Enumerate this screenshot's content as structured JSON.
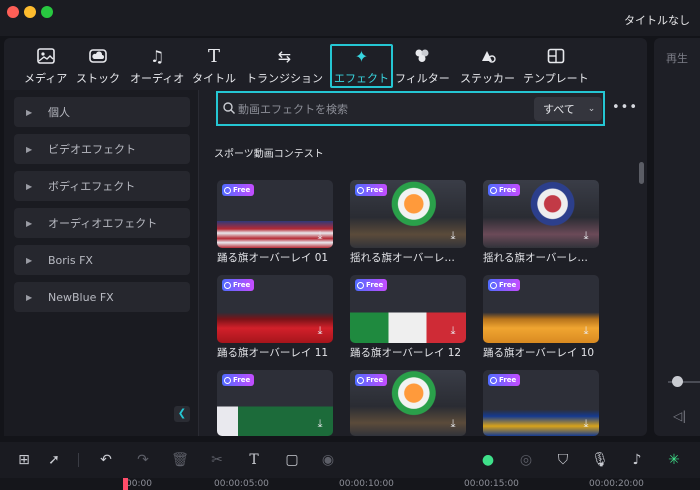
{
  "window": {
    "title": "タイトルなし"
  },
  "tabs": [
    {
      "label": "メディア",
      "icon": "media-icon"
    },
    {
      "label": "ストック",
      "icon": "cloud-icon"
    },
    {
      "label": "オーディオ",
      "icon": "music-icon"
    },
    {
      "label": "タイトル",
      "icon": "title-icon"
    },
    {
      "label": "トランジション",
      "icon": "transition-icon"
    },
    {
      "label": "エフェクト",
      "icon": "effect-icon",
      "active": true
    },
    {
      "label": "フィルター",
      "icon": "filter-icon"
    },
    {
      "label": "ステッカー",
      "icon": "sticker-icon"
    },
    {
      "label": "テンプレート",
      "icon": "template-icon"
    }
  ],
  "player": {
    "label": "再生"
  },
  "sidebar": {
    "items": [
      {
        "label": "個人"
      },
      {
        "label": "ビデオエフェクト"
      },
      {
        "label": "ボディエフェクト"
      },
      {
        "label": "オーディオエフェクト"
      },
      {
        "label": "Boris FX"
      },
      {
        "label": "NewBlue FX"
      }
    ]
  },
  "search": {
    "placeholder": "動画エフェクトを検索",
    "filter": "すべて"
  },
  "section": {
    "title": "スポーツ動画コンテスト"
  },
  "badge": {
    "free": "Free"
  },
  "effects": [
    {
      "label": "踊る旗オーバーレイ 01",
      "theme": "usa-flat"
    },
    {
      "label": "揺れる旗オーバーレ…",
      "theme": "india-crowd"
    },
    {
      "label": "揺れる旗オーバーレ…",
      "theme": "usa-crowd"
    },
    {
      "label": "踊る旗オーバーレイ 11",
      "theme": "red"
    },
    {
      "label": "踊る旗オーバーレイ 12",
      "theme": "italy"
    },
    {
      "label": "踊る旗オーバーレイ 10",
      "theme": "orange"
    },
    {
      "label": "",
      "theme": "green"
    },
    {
      "label": "",
      "theme": "india-crowd"
    },
    {
      "label": "",
      "theme": "blue"
    }
  ],
  "timeline": {
    "ticks": [
      "00:00",
      "00:00:05:00",
      "00:00:10:00",
      "00:00:15:00",
      "00:00:20:00"
    ]
  },
  "colors": {
    "accent": "#25c6d3",
    "free_badge": "#8a56ff",
    "ai_green": "#3fe08a"
  }
}
